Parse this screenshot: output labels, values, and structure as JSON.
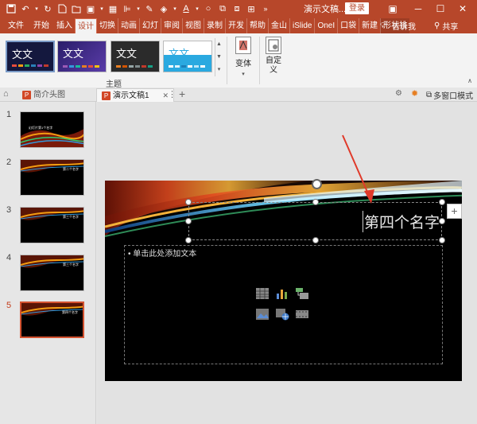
{
  "titlebar": {
    "doc_title": "演示文稿...",
    "login_label": "登录",
    "accent": "#b7472a",
    "qat_icons": [
      "save-icon",
      "undo-icon",
      "redo-icon",
      "new-file-icon",
      "open-icon",
      "picture-icon",
      "table-icon",
      "align-icon",
      "eyedropper-icon",
      "fill-icon",
      "font-color-icon",
      "shape-icon",
      "bring-forward-icon",
      "send-backward-icon",
      "group-icon"
    ]
  },
  "tabs": [
    "文件",
    "开始",
    "插入",
    "设计",
    "切换",
    "动画",
    "幻灯",
    "审阅",
    "视图",
    "录制",
    "开发",
    "帮助",
    "金山",
    "iSlide",
    "OneI",
    "口袋",
    "新建",
    "形状排"
  ],
  "active_tab": "设计",
  "tell_me": "告诉我",
  "share": "共享",
  "ribbon": {
    "themes": [
      {
        "text": "文文",
        "bg": "#1b1f4a"
      },
      {
        "text": "文文",
        "bg": "#3a2a7a"
      },
      {
        "text": "文文",
        "bg": "#2b2b2b"
      },
      {
        "text": "文文",
        "bg": "#2aa9e0"
      }
    ],
    "themes_group_label": "主题",
    "variants_label": "变体",
    "customize_label": "自定\n义"
  },
  "doc_tabs": {
    "tab1": "简介头图",
    "tab2": "演示文稿1",
    "multi_window": "多窗口模式"
  },
  "slides": [
    {
      "number": "1",
      "title": "幻灯片第1个名字"
    },
    {
      "number": "2",
      "title": "第二个名字"
    },
    {
      "number": "3",
      "title": "第三个名字"
    },
    {
      "number": "4",
      "title": "第三个名字"
    },
    {
      "number": "5",
      "title": "第四个名字"
    }
  ],
  "current_slide": {
    "title": "第四个名字",
    "content_placeholder": "• 单击此处添加文本"
  }
}
